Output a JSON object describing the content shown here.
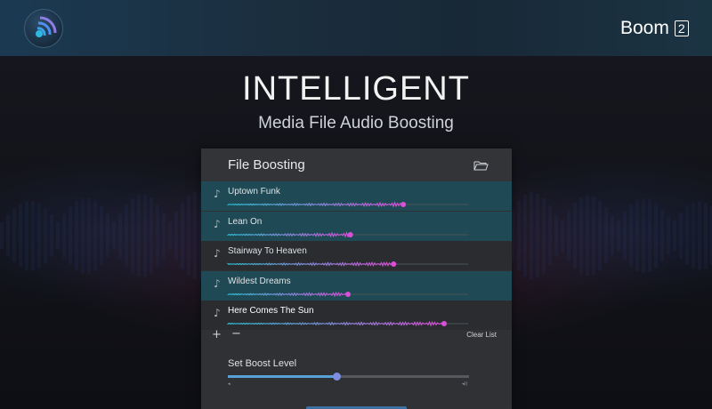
{
  "header": {
    "logo_icon": "speaker-waves-icon",
    "brand_name": "Boom",
    "brand_version": "2"
  },
  "hero": {
    "title": "INTELLIGENT",
    "subtitle": "Media File Audio Boosting"
  },
  "panel": {
    "title": "File Boosting",
    "folder_icon": "folder-open-icon",
    "tracks": [
      {
        "name": "Uptown Funk",
        "selected": true,
        "boost": 0.73
      },
      {
        "name": "Lean On",
        "selected": true,
        "boost": 0.51
      },
      {
        "name": "Stairway To Heaven",
        "selected": false,
        "boost": 0.69
      },
      {
        "name": "Wildest Dreams",
        "selected": true,
        "boost": 0.5
      },
      {
        "name": "Here Comes The Sun",
        "selected": false,
        "boost": 0.9
      }
    ],
    "add_label": "+",
    "remove_label": "−",
    "clear_label": "Clear List",
    "boost": {
      "label": "Set Boost Level",
      "value": 0.45,
      "min_label": "◂",
      "max_label": "◂))"
    }
  },
  "colors": {
    "accent_cyan": "#2fc3d9",
    "accent_magenta": "#d94fd6",
    "selected_row": "#1f4a55"
  }
}
